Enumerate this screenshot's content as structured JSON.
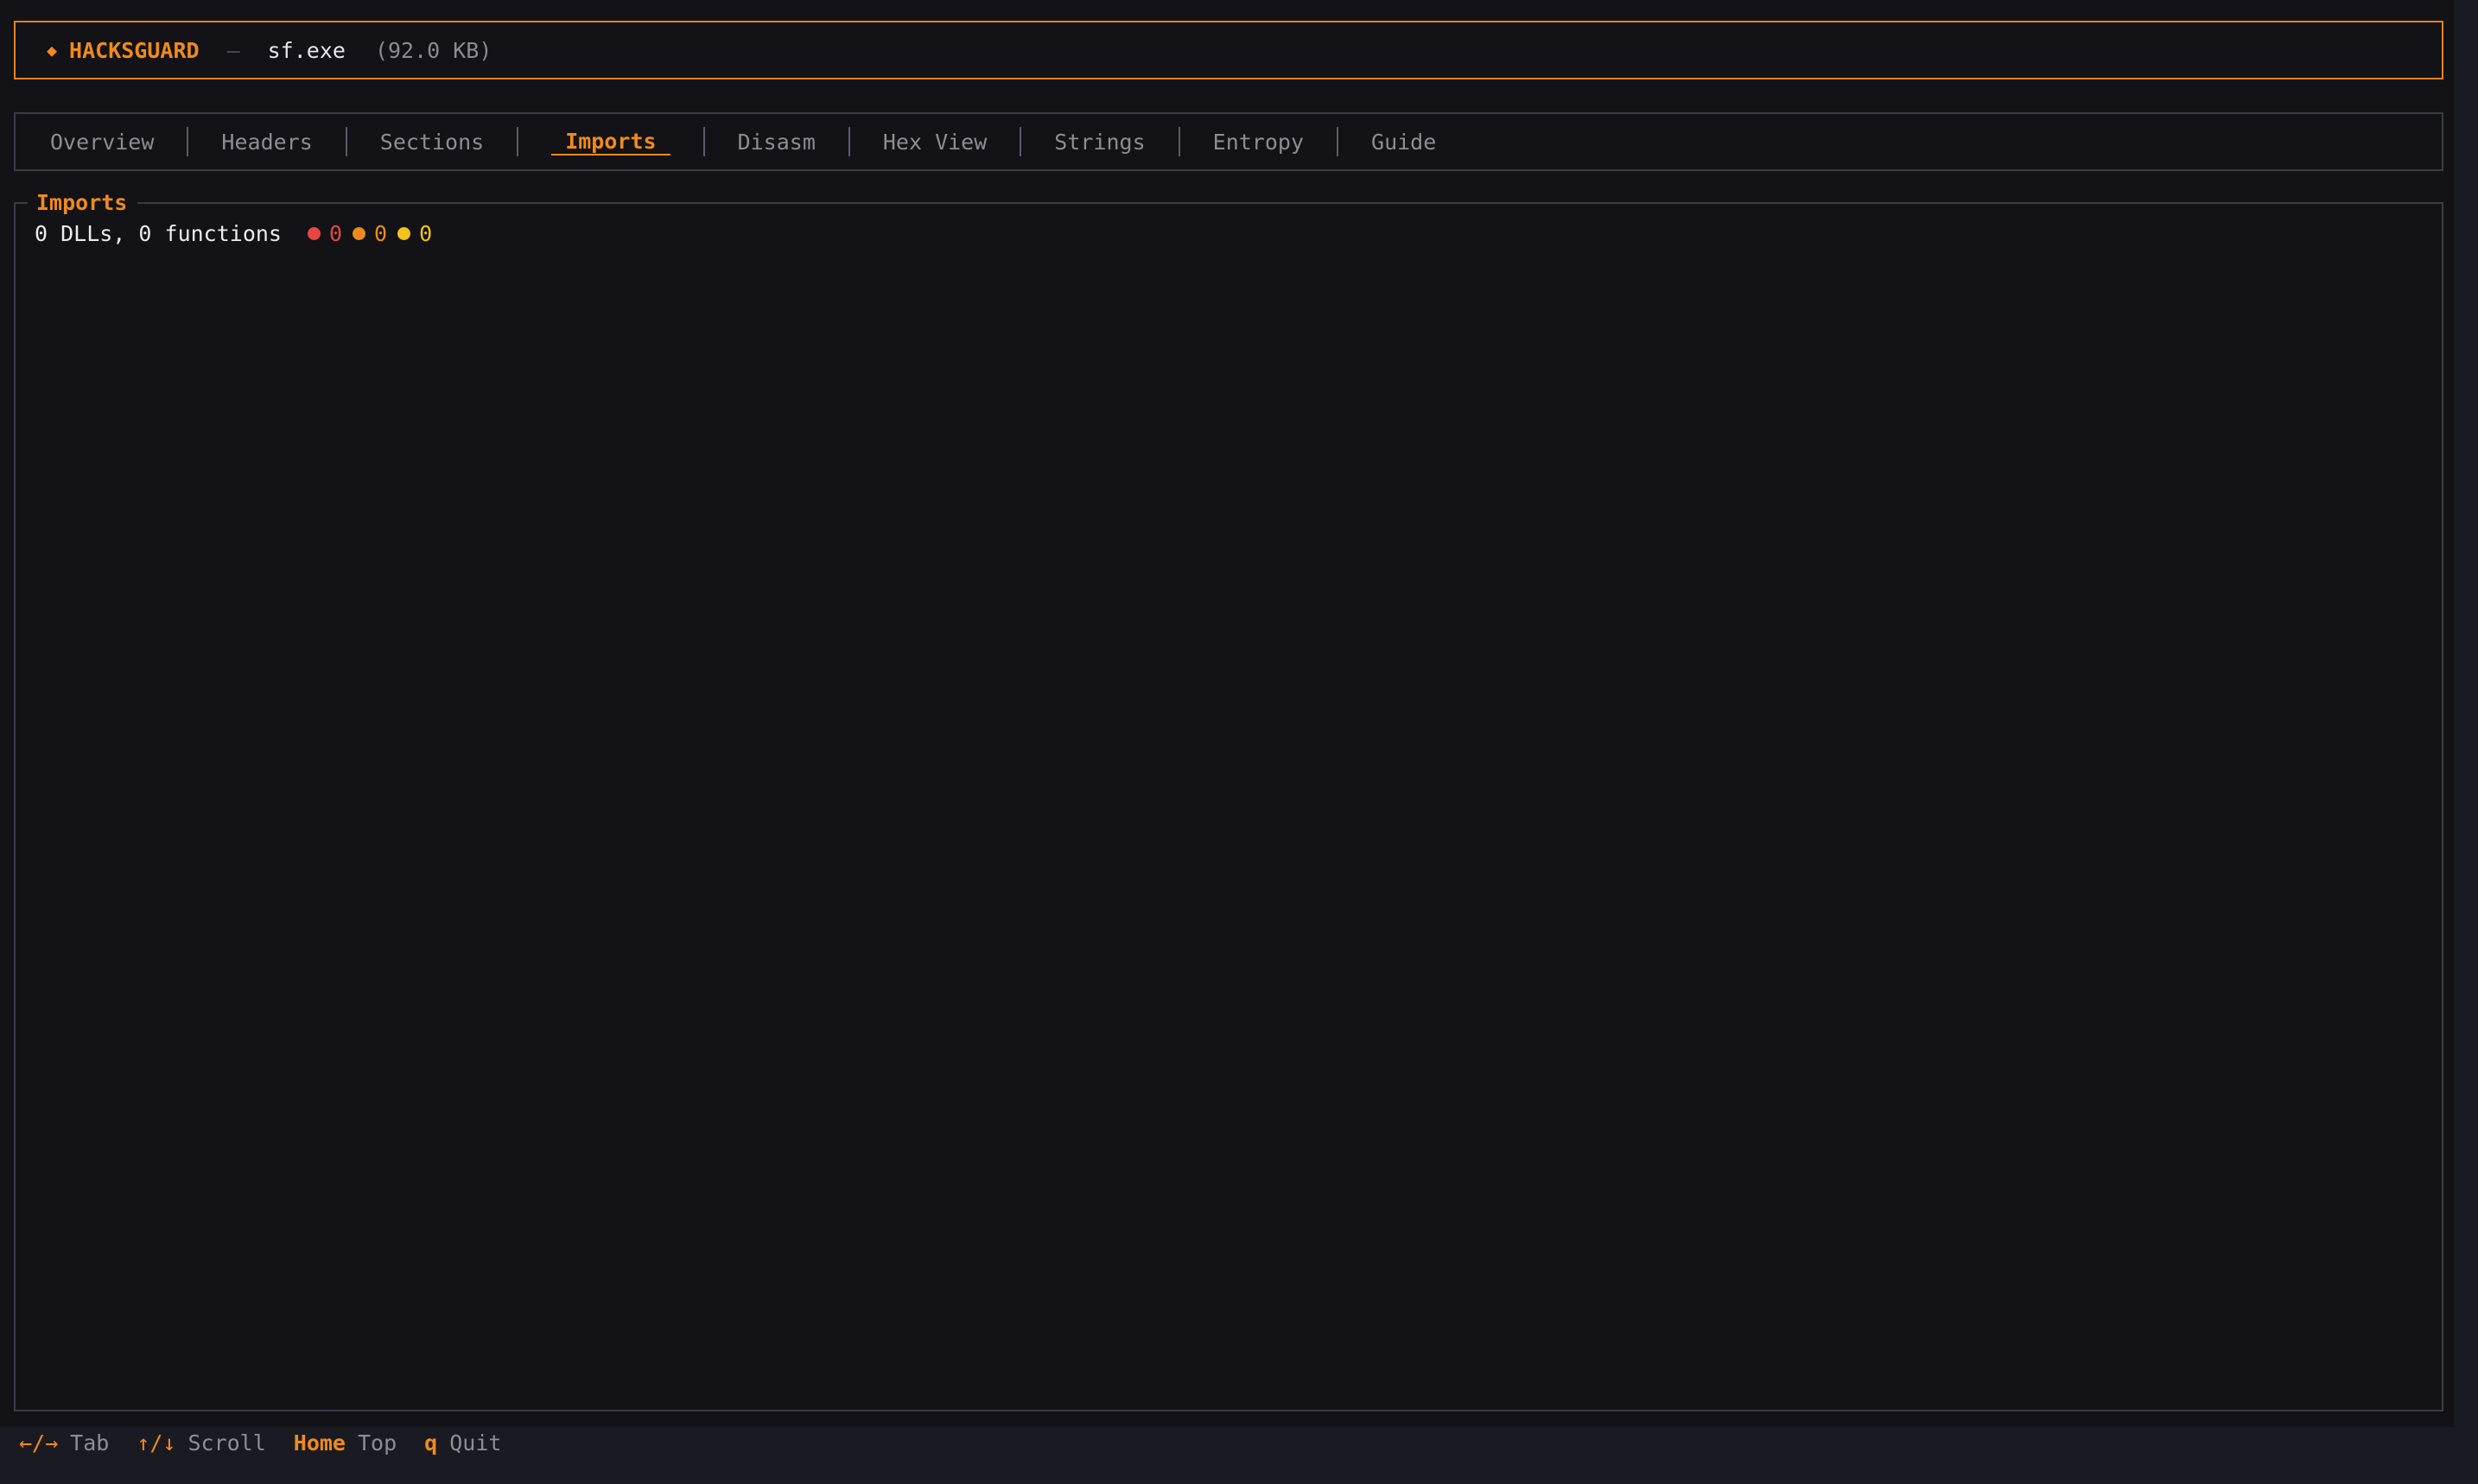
{
  "header": {
    "brand_icon": "◆",
    "brand": "HACKSGUARD",
    "separator": "—",
    "filename": "sf.exe",
    "filesize": "(92.0 KB)"
  },
  "tabs": [
    {
      "label": "Overview",
      "active": false
    },
    {
      "label": "Headers",
      "active": false
    },
    {
      "label": "Sections",
      "active": false
    },
    {
      "label": "Imports",
      "active": true
    },
    {
      "label": "Disasm",
      "active": false
    },
    {
      "label": "Hex View",
      "active": false
    },
    {
      "label": "Strings",
      "active": false
    },
    {
      "label": "Entropy",
      "active": false
    },
    {
      "label": "Guide",
      "active": false
    }
  ],
  "panel": {
    "title": "Imports",
    "summary": "0 DLLs, 0 functions",
    "severity_counts": [
      {
        "level": "critical",
        "color": "#e84545",
        "count": "0"
      },
      {
        "level": "high",
        "color": "#f08a1c",
        "count": "0"
      },
      {
        "level": "medium",
        "color": "#f2c418",
        "count": "0"
      }
    ]
  },
  "footer": {
    "hints": [
      {
        "key": "←/→",
        "action": "Tab",
        "bold": false
      },
      {
        "key": "↑/↓",
        "action": "Scroll",
        "bold": false
      },
      {
        "key": "Home",
        "action": "Top",
        "bold": true
      },
      {
        "key": "q",
        "action": "Quit",
        "bold": true
      }
    ]
  },
  "colors": {
    "accent": "#f08a1c",
    "background": "#121217",
    "border": "#3a3c45",
    "muted_text": "#8c8d95"
  }
}
